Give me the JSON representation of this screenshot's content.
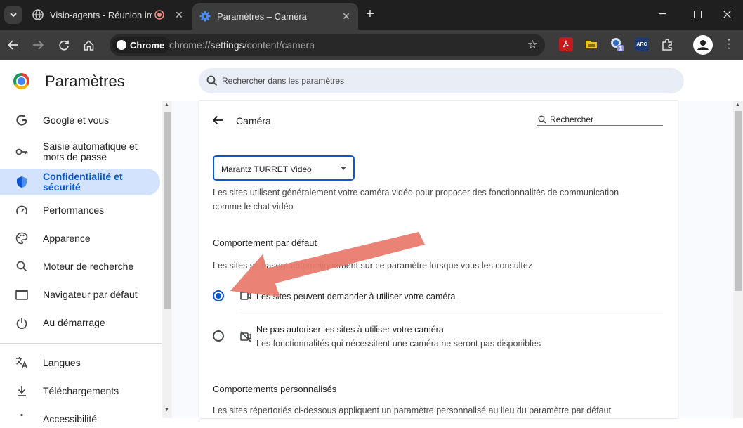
{
  "tabs": [
    {
      "title": "Visio-agents - Réunion impr",
      "active": false,
      "recording": true
    },
    {
      "title": "Paramètres – Caméra",
      "active": true
    }
  ],
  "omnibox": {
    "chip_label": "Chrome",
    "url_scheme": "chrome://",
    "url_domain": "settings",
    "url_path": "/content/camera"
  },
  "extensions": [
    {
      "name": "pdf-extension-icon",
      "color": "#e02020"
    },
    {
      "name": "folder-extension-icon",
      "color": "#f0c020"
    },
    {
      "name": "badge-extension-icon",
      "color": "#1a73e8",
      "badge": "1"
    },
    {
      "name": "arc-extension-icon",
      "color": "#1e3a6e",
      "text": "ARC"
    }
  ],
  "header": {
    "title": "Paramètres",
    "search_placeholder": "Rechercher dans les paramètres"
  },
  "sidebar": {
    "items": [
      {
        "label": "Google et vous",
        "icon": "google-icon"
      },
      {
        "label": "Saisie automatique et mots de passe",
        "icon": "key-icon"
      },
      {
        "label": "Confidentialité et sécurité",
        "icon": "shield-icon",
        "selected": true
      },
      {
        "label": "Performances",
        "icon": "gauge-icon"
      },
      {
        "label": "Apparence",
        "icon": "palette-icon"
      },
      {
        "label": "Moteur de recherche",
        "icon": "search-icon"
      },
      {
        "label": "Navigateur par défaut",
        "icon": "browser-icon"
      },
      {
        "label": "Au démarrage",
        "icon": "power-icon"
      },
      {
        "label": "Langues",
        "icon": "translate-icon"
      },
      {
        "label": "Téléchargements",
        "icon": "download-icon"
      },
      {
        "label": "Accessibilité",
        "icon": "accessibility-icon"
      }
    ]
  },
  "page": {
    "title": "Caméra",
    "search_placeholder": "Rechercher",
    "device_select": "Marantz TURRET Video",
    "device_description_1": "Les sites utilisent généralement votre caméra vidéo pour proposer des fonctionnalités de communication",
    "device_description_2": "comme le chat vidéo",
    "default_heading": "Comportement par défaut",
    "default_description": "Les sites se basent automatiquement sur ce paramètre lorsque vous les consultez",
    "options": [
      {
        "label": "Les sites peuvent demander à utiliser votre caméra",
        "selected": true
      },
      {
        "label": "Ne pas autoriser les sites à utiliser votre caméra",
        "sublabel": "Les fonctionnalités qui nécessitent une caméra ne seront pas disponibles",
        "selected": false
      }
    ],
    "custom_heading": "Comportements personnalisés",
    "custom_description": "Les sites répertoriés ci-dessous appliquent un paramètre personnalisé au lieu du paramètre par défaut"
  },
  "annotation": {
    "color": "#e8786c"
  }
}
